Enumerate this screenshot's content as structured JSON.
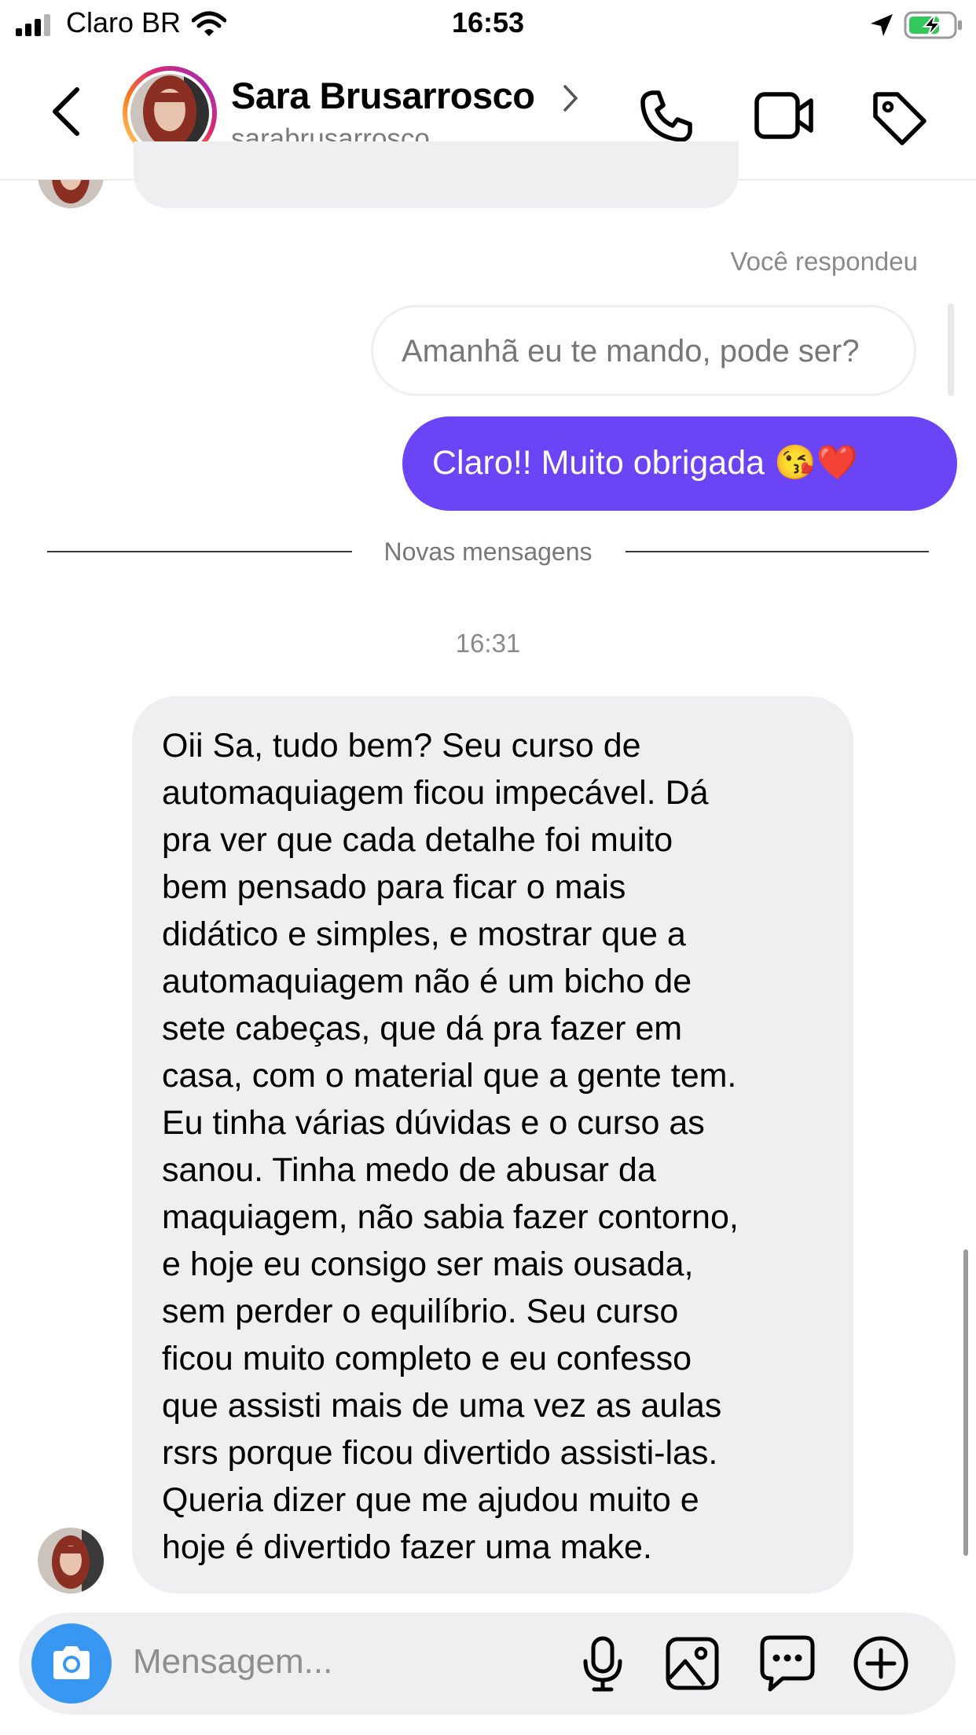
{
  "status_bar": {
    "carrier": "Claro BR",
    "time": "16:53"
  },
  "header": {
    "name": "Sara Brusarrosco",
    "username": "sarabrusarrosco"
  },
  "messages": {
    "reply_label": "Você respondeu",
    "replied_text": "Amanhã eu te mando, pode ser?",
    "sent_text": "Claro!! Muito obrigada 😘❤️",
    "divider_label": "Novas mensagens",
    "timestamp": "16:31",
    "received_lines": [
      "Oii Sa, tudo bem? Seu curso de",
      "automaquiagem ficou impecável. Dá",
      "pra ver que cada detalhe foi muito",
      "bem pensado para ficar o mais",
      "didático e simples, e mostrar que a",
      "automaquiagem não é um bicho de",
      "sete cabeças, que dá pra fazer em",
      "casa, com o material que a gente tem.",
      "Eu tinha várias dúvidas e o curso as",
      "sanou. Tinha medo de abusar da",
      "maquiagem, não sabia fazer contorno,",
      "e hoje eu consigo ser mais ousada,",
      "sem perder o equilíbrio. Seu curso",
      "ficou muito completo e eu confesso",
      "que assisti mais de uma vez as aulas",
      "rsrs porque ficou divertido assisti-las.",
      "Queria dizer que me ajudou muito e",
      "hoje é divertido fazer uma make."
    ]
  },
  "composer": {
    "placeholder": "Mensagem..."
  },
  "colors": {
    "accent": "#6b44f5",
    "camera": "#3897f0",
    "bubble": "#efeff1"
  }
}
